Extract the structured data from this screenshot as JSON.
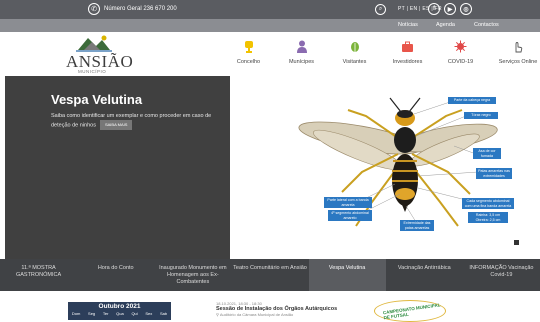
{
  "topbar": {
    "phone_label": "Número Geral 236 670 200",
    "languages": "PT | EN | ES | FR",
    "socials": [
      "f",
      "▶",
      "◎"
    ]
  },
  "subnav": {
    "items": [
      "Notícias",
      "Agenda",
      "Contactos"
    ]
  },
  "logo": {
    "name": "ANSIÃO",
    "sub": "MUNICÍPIO"
  },
  "mainnav": {
    "items": [
      {
        "label": "Concelho",
        "icon": "trophy-icon",
        "color": "#f2c300"
      },
      {
        "label": "Munícipes",
        "icon": "person-icon",
        "color": "#8a6bb0"
      },
      {
        "label": "Visitantes",
        "icon": "leaf-icon",
        "color": "#7bb33a"
      },
      {
        "label": "Investidores",
        "icon": "briefcase-icon",
        "color": "#e8554a"
      },
      {
        "label": "COVID-19",
        "icon": "virus-icon",
        "color": "#e04848"
      },
      {
        "label": "Serviços Online",
        "icon": "hand-icon",
        "color": "#555555"
      }
    ]
  },
  "hero": {
    "title": "Vespa Velutina",
    "text": "Saiba como identificar um exemplar e como proceder em caso de deteção de ninhos",
    "button": "SAIBA MAIS",
    "callouts": [
      "Parte da cabeça negra",
      "Tórax negro",
      "Asa de cor fumada",
      "Patas amarelas nas extremidades",
      "Cada segmento abdominal com uma fina banda amarela",
      "4º segmento abdominal amarelo",
      "Extremidade das patas amarelas",
      "Parte lateral com a banda amarela",
      "Rainha: 3,5 cm  Obreira: 2,5 cm"
    ]
  },
  "tabs": {
    "items": [
      "11.ª MOSTRA GASTRONÓMICA",
      "Hora do Conto",
      "Inaugurado Monumento em Homenagem aos Ex-Combatentes",
      "Teatro Comunitário em Ansião",
      "Vespa Velutina",
      "Vacinação Antirrábica",
      "INFORMAÇÃO Vacinação Covid-19"
    ],
    "active_index": 4
  },
  "calendar": {
    "month": "Outubro 2021",
    "days": [
      "Dom",
      "Seg",
      "Ter",
      "Qua",
      "Qui",
      "Sex",
      "Sab"
    ]
  },
  "event": {
    "date": "18.10.2021, 18:30 - 18:30",
    "title": "Sessão de Instalação dos Órgãos Autárquicos",
    "location": "Auditório da Câmara Municipal de Ansião"
  },
  "badge": {
    "text": "CAMPEONATO MUNICIPAL DE FUTSAL"
  }
}
